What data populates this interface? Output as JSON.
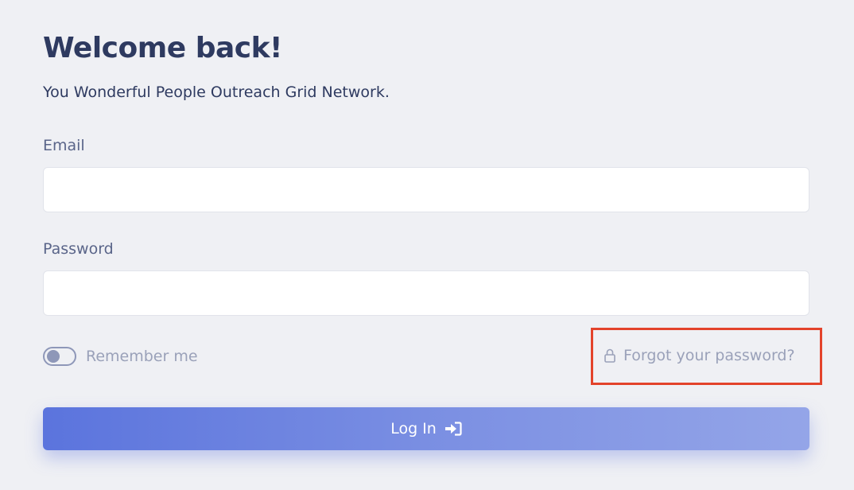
{
  "header": {
    "title": "Welcome back!",
    "subtitle": "You Wonderful People Outreach Grid Network."
  },
  "form": {
    "email": {
      "label": "Email",
      "value": "",
      "placeholder": ""
    },
    "password": {
      "label": "Password",
      "value": "",
      "placeholder": ""
    },
    "remember": {
      "label": "Remember me",
      "checked": false
    },
    "forgot": {
      "label": "Forgot your password?",
      "icon": "lock-icon"
    },
    "submit": {
      "label": "Log In",
      "icon": "sign-in-icon"
    }
  },
  "colors": {
    "background": "#eff0f4",
    "title": "#2e3a60",
    "muted": "#9aa1b9",
    "accent": "#5b74dd",
    "highlight": "#e3432b"
  }
}
